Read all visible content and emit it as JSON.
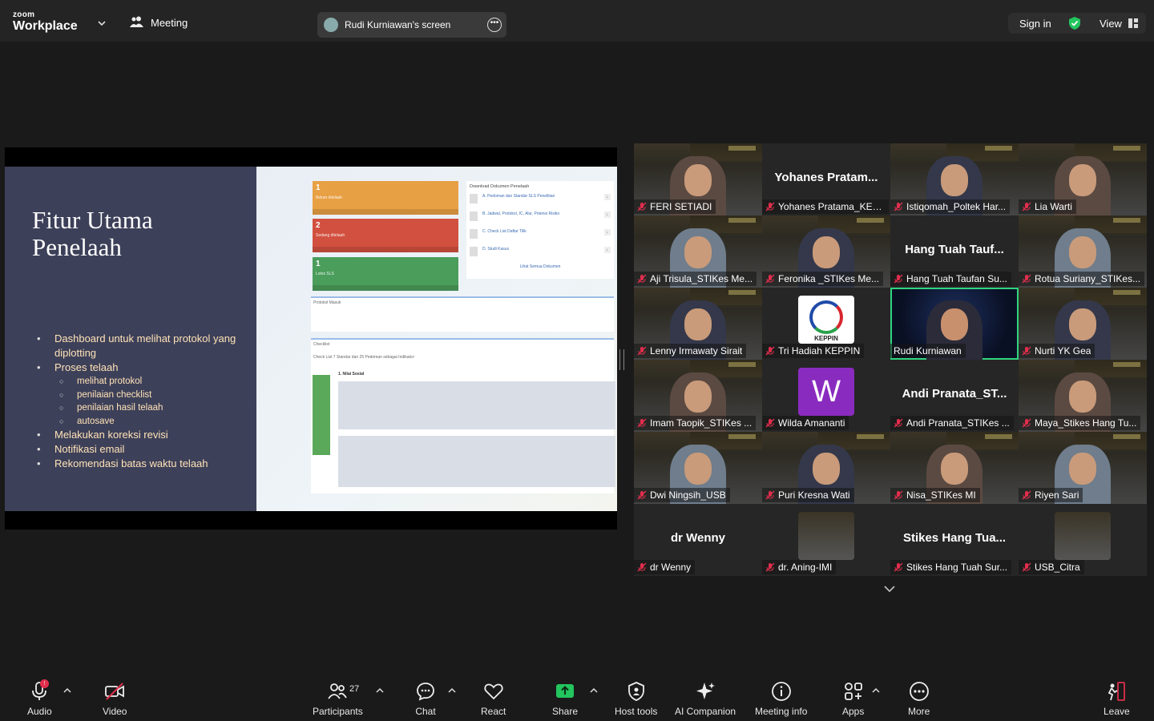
{
  "topbar": {
    "brand_small": "zoom",
    "brand": "Workplace",
    "meeting_label": "Meeting",
    "screen_share_label": "Rudi Kurniawan's screen",
    "signin_label": "Sign in",
    "view_label": "View"
  },
  "slide": {
    "title": "Fitur Utama Penelaah",
    "bullets": [
      {
        "text": "Dashboard untuk melihat protokol yang diplotting",
        "level": 1
      },
      {
        "text": "Proses telaah",
        "level": 1
      },
      {
        "text": "melihat protokol",
        "level": 2
      },
      {
        "text": "penilaian checklist",
        "level": 2
      },
      {
        "text": "penilaian hasil telaah",
        "level": 2
      },
      {
        "text": "autosave",
        "level": 2
      },
      {
        "text": "Melakukan koreksi revisi",
        "level": 1
      },
      {
        "text": "Notifikasi email",
        "level": 1
      },
      {
        "text": "Rekomendasi batas waktu telaah",
        "level": 1
      }
    ],
    "cards": [
      {
        "num": "1",
        "label": "Belum ditelaah",
        "color": "#e8a044"
      },
      {
        "num": "2",
        "label": "Sedang ditelaah",
        "color": "#d2503f"
      },
      {
        "num": "1",
        "label": "Lolos SLS",
        "color": "#4a9d5b"
      }
    ],
    "download_title": "Download Dokumen Penelaah",
    "downloads": [
      "A. Pedoman dan Standar SLS Penelitian",
      "B. Jadwal, Protokol, IC, Alur, Potensi Risiko",
      "C. Check List Daftar Tilik",
      "D. Studi Kasus"
    ],
    "download_all": "Lihat Semua Dokumen",
    "protokol_title": "Protokol Masuk",
    "checklist_title": "Checklist",
    "checklist_desc": "Check List 7 Standar dan 25 Pedoman sebagai Indikator:",
    "nilai_sosial": "1. Nilai Sosial"
  },
  "participants": [
    {
      "name": "FERI SETIADI",
      "big": "",
      "style": "img"
    },
    {
      "name": "Yohanes Pratama_KEPPIN",
      "big": "Yohanes  Pratam...",
      "style": "dark"
    },
    {
      "name": "Istiqomah_Poltek Har...",
      "big": "",
      "style": "img"
    },
    {
      "name": "Lia Warti",
      "big": "",
      "style": "img"
    },
    {
      "name": "Aji Trisula_STIKes Me...",
      "big": "",
      "style": "img"
    },
    {
      "name": "Feronika _STIKes Me...",
      "big": "",
      "style": "img"
    },
    {
      "name": "Hang Tuah Taufan Su...",
      "big": "Hang Tuah  Tauf...",
      "style": "dark"
    },
    {
      "name": "Rotua Suriany_STIKes...",
      "big": "",
      "style": "img"
    },
    {
      "name": "Lenny Irmawaty Sirait",
      "big": "",
      "style": "img"
    },
    {
      "name": "Tri Hadiah KEPPIN",
      "big": "",
      "style": "keppin"
    },
    {
      "name": "Rudi Kurniawan",
      "big": "",
      "style": "active"
    },
    {
      "name": "Nurti YK Gea",
      "big": "",
      "style": "img"
    },
    {
      "name": "Imam Taopik_STIKes ...",
      "big": "",
      "style": "img"
    },
    {
      "name": "Wilda Amananti",
      "big": "",
      "style": "w"
    },
    {
      "name": "Andi Pranata_STIKes ...",
      "big": "Andi  Pranata_ST...",
      "style": "dark"
    },
    {
      "name": "Maya_Stikes Hang Tu...",
      "big": "",
      "style": "img"
    },
    {
      "name": "Dwi Ningsih_USB",
      "big": "",
      "style": "img"
    },
    {
      "name": "Puri Kresna Wati",
      "big": "",
      "style": "img"
    },
    {
      "name": "Nisa_STIKes MI",
      "big": "",
      "style": "img"
    },
    {
      "name": "Riyen Sari",
      "big": "",
      "style": "img"
    },
    {
      "name": "dr Wenny",
      "big": "dr Wenny",
      "style": "dark"
    },
    {
      "name": "dr. Aning-IMI",
      "big": "",
      "style": "photo"
    },
    {
      "name": "Stikes Hang Tuah Sur...",
      "big": "Stikes  Hang  Tua...",
      "style": "dark"
    },
    {
      "name": "USB_Citra",
      "big": "",
      "style": "photo"
    }
  ],
  "keppin_logo_text": "KEPPIN",
  "wilda_initial": "W",
  "toolbar": {
    "audio": "Audio",
    "audio_badge": "!",
    "video": "Video",
    "participants": "Participants",
    "participants_count": "27",
    "chat": "Chat",
    "react": "React",
    "share": "Share",
    "host_tools": "Host tools",
    "ai_companion": "AI Companion",
    "meeting_info": "Meeting info",
    "apps": "Apps",
    "more": "More",
    "leave": "Leave"
  },
  "colors": {
    "share_green": "#22c55e",
    "leave_red": "#e02e4c",
    "active_speaker": "#2fd57f",
    "mic_muted": "#e02e4c"
  }
}
